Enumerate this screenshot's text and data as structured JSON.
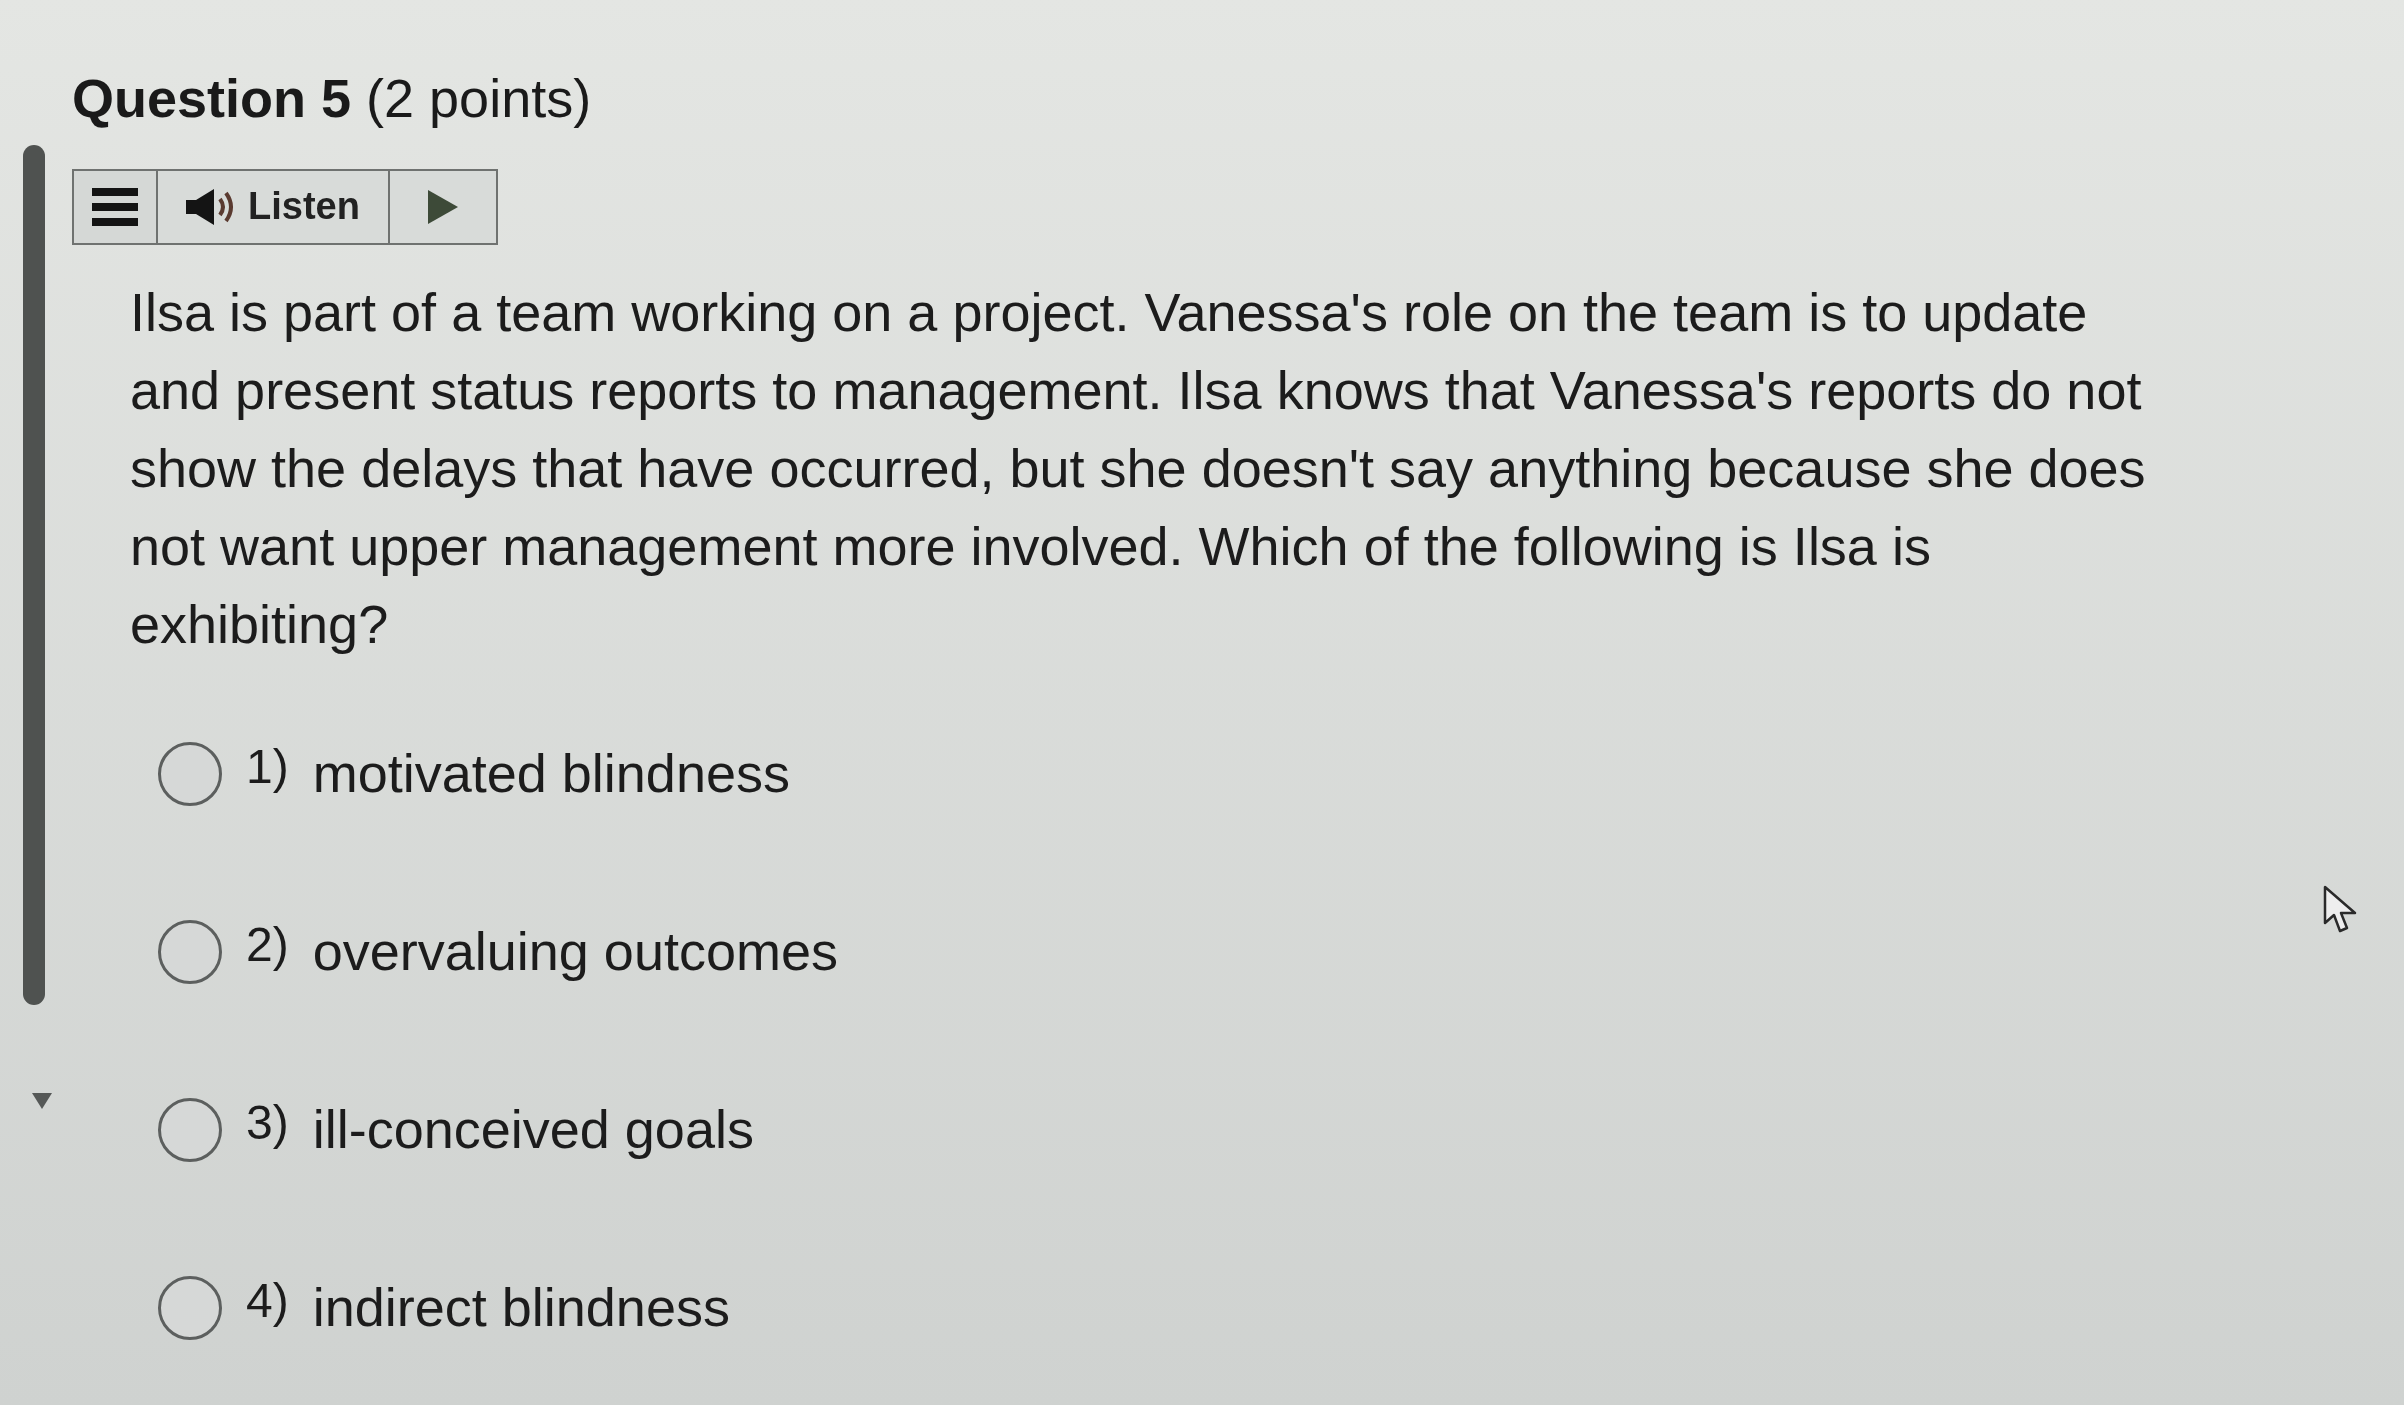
{
  "question": {
    "title": "**Question 5** (2 points)"
  },
  "toolbar": {
    "listen_label": "Listen"
  },
  "prompt": "Ilsa is part of a team working on a project. Vanessa's role on the team is to update and present status reports to management. Ilsa knows that Vanessa's reports do not show the delays that have occurred, but she doesn't say anything because she does not want upper management more involved. Which of the following is Ilsa is exhibiting?",
  "options": [
    {
      "number": "1)",
      "label": "motivated blindness",
      "selected": false
    },
    {
      "number": "2)",
      "label": "overvaluing outcomes",
      "selected": false
    },
    {
      "number": "3)",
      "label": "ill-conceived goals",
      "selected": false
    },
    {
      "number": "4)",
      "label": "indirect blindness",
      "selected": false
    }
  ]
}
